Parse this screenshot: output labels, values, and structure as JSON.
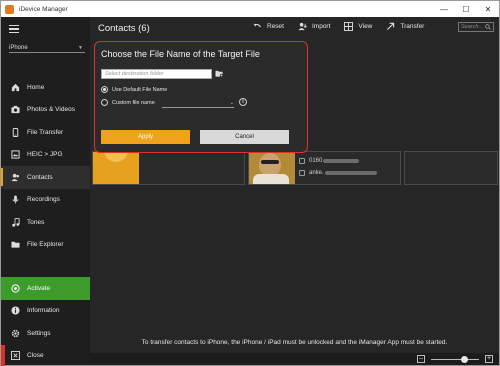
{
  "window": {
    "title": "iDevice Manager"
  },
  "sidebar": {
    "device": "iPhone",
    "items": [
      {
        "label": "Home",
        "icon": "home-icon"
      },
      {
        "label": "Photos & Videos",
        "icon": "camera-icon"
      },
      {
        "label": "File Transfer",
        "icon": "phone-transfer-icon"
      },
      {
        "label": "HEIC > JPG",
        "icon": "convert-icon"
      },
      {
        "label": "Contacts",
        "icon": "contacts-icon",
        "active": true
      },
      {
        "label": "Recordings",
        "icon": "microphone-icon"
      },
      {
        "label": "Tones",
        "icon": "music-note-icon"
      },
      {
        "label": "File Explorer",
        "icon": "folder-icon"
      }
    ],
    "bottom": [
      {
        "label": "Activate",
        "icon": "activate-icon"
      },
      {
        "label": "Information",
        "icon": "info-icon"
      },
      {
        "label": "Settings",
        "icon": "gear-icon"
      },
      {
        "label": "Close",
        "icon": "close-icon"
      }
    ]
  },
  "main": {
    "title": "Contacts (6)",
    "toolbar": {
      "reset": "Reset",
      "import": "Import",
      "view": "View",
      "transfer": "Transfer"
    },
    "search_placeholder": "Search...",
    "cards": [
      {
        "line1": "0160",
        "line2": "anke."
      }
    ],
    "footer_message": "To transfer contacts to iPhone, the iPhone / iPad must be unlocked and the iManager App must be started.",
    "zoom_level": 0.7
  },
  "dialog": {
    "title": "Choose the File Name of the Target File",
    "destination_placeholder": "Select destination folder",
    "option_default": "Use Default File Name",
    "option_custom": "Custom file name",
    "apply": "Apply",
    "cancel": "Cancel"
  },
  "colors": {
    "accent": "#f0a21c",
    "activate": "#3c9b2b",
    "close": "#d9302a",
    "dialog_border": "#e0302a"
  }
}
